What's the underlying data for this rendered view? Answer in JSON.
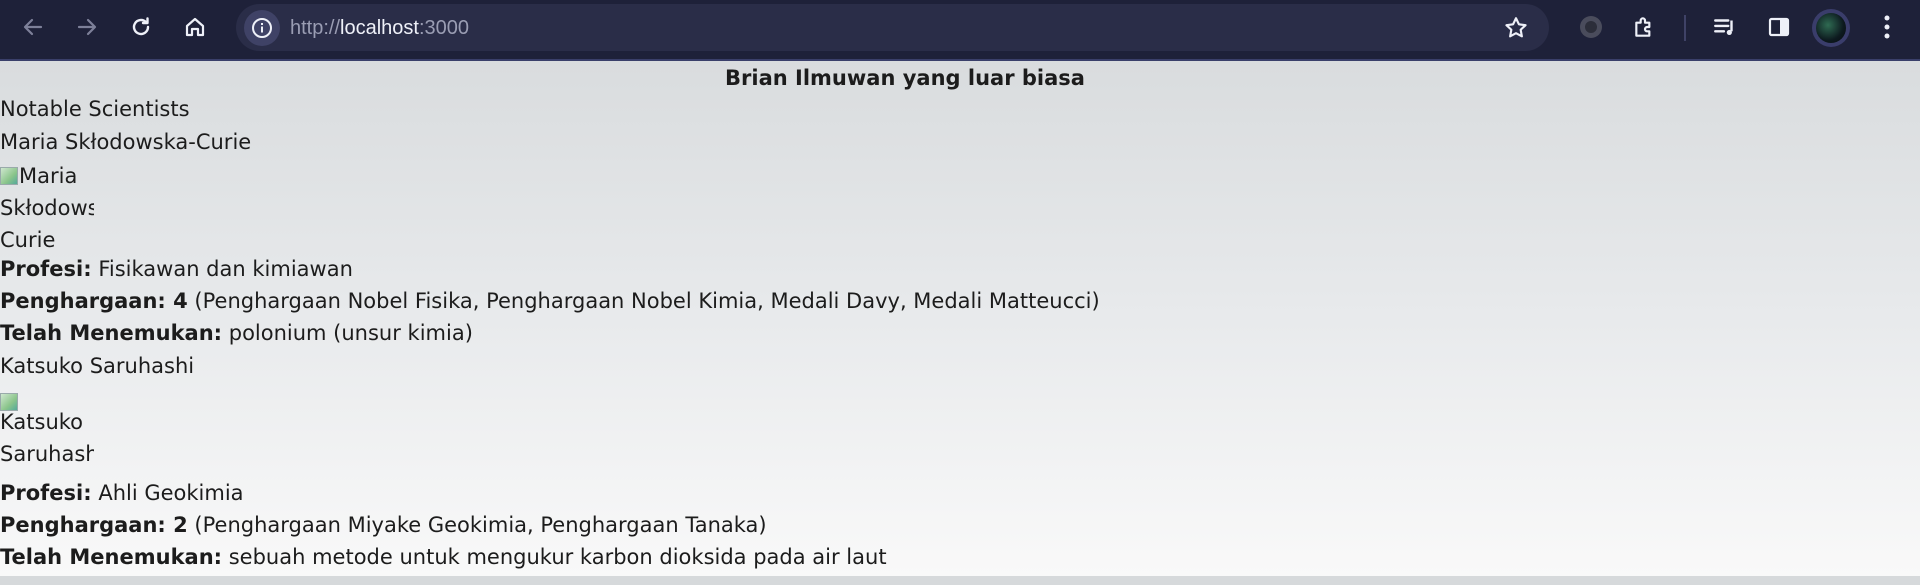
{
  "browser": {
    "url_scheme": "http://",
    "url_host": "localhost",
    "url_port": ":3000"
  },
  "page": {
    "title": "Brian Ilmuwan yang luar biasa",
    "section_heading": "Notable Scientists",
    "scientists": [
      {
        "name": "Maria Skłodowska-Curie",
        "image_alt_lines": [
          "Maria",
          "Skłodows",
          "Curie"
        ],
        "profession_label": "Profesi:",
        "profession": " Fisikawan dan kimiawan",
        "awards_label": "Penghargaan: 4",
        "awards": " (Penghargaan Nobel Fisika, Penghargaan Nobel Kimia, Medali Davy, Medali Matteucci)",
        "discovered_label": "Telah Menemukan:",
        "discovered": " polonium (unsur kimia)"
      },
      {
        "name": "Katsuko Saruhashi",
        "image_alt_lines": [
          "Katsuko",
          "Saruhash"
        ],
        "profession_label": "Profesi:",
        "profession": " Ahli Geokimia",
        "awards_label": "Penghargaan: 2",
        "awards": " (Penghargaan Miyake Geokimia, Penghargaan Tanaka)",
        "discovered_label": "Telah Menemukan:",
        "discovered": " sebuah metode untuk mengukur karbon dioksida pada air laut"
      }
    ]
  }
}
